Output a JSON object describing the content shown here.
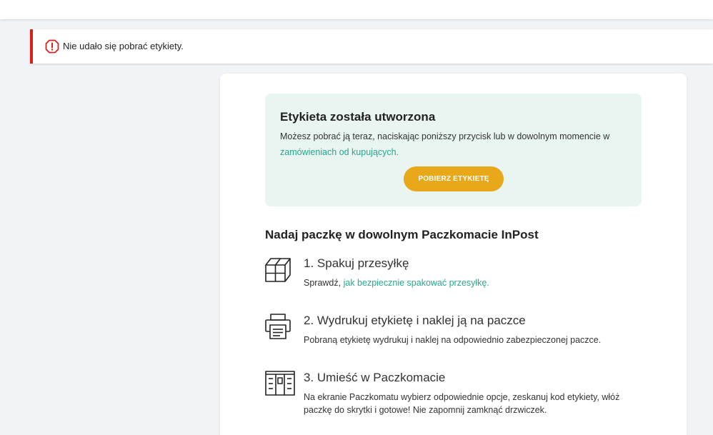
{
  "alert": {
    "message": "Nie udało się pobrać etykiety."
  },
  "success": {
    "title": "Etykieta została utworzona",
    "description": "Możesz pobrać ją teraz, naciskając poniższy przycisk lub w dowolnym momencie w ",
    "link": "zamówieniach od kupujących.",
    "button_label": "POBIERZ ETYKIETĘ"
  },
  "section": {
    "title": "Nadaj paczkę w dowolnym Paczkomacie InPost"
  },
  "steps": [
    {
      "icon": "box-icon",
      "title": "1. Spakuj przesyłkę",
      "desc_prefix": "Sprawdź, ",
      "desc_link": "jak bezpiecznie spakować przesyłkę."
    },
    {
      "icon": "printer-icon",
      "title": "2. Wydrukuj etykietę i naklej ją na paczce",
      "desc": "Pobraną etykietę wydrukuj i naklej na odpowiednio zabezpieczonej paczce."
    },
    {
      "icon": "parcel-locker-icon",
      "title": "3. Umieść w Paczkomacie",
      "desc": "Na ekranie Paczkomatu wybierz odpowiednie opcje, zeskanuj kod etykiety, włóż paczkę do skrytki i gotowe! Nie zapomnij zamknąć drzwiczek."
    }
  ],
  "colors": {
    "error": "#d0241c",
    "accent": "#27a78e",
    "button": "#e8a81a",
    "success_bg": "#e9f5f1"
  }
}
